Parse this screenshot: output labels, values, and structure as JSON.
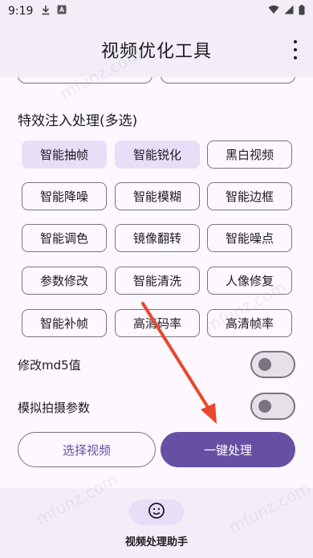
{
  "status_bar": {
    "time": "9:19",
    "icons": [
      "download-icon",
      "a-box-icon"
    ],
    "right_icons": [
      "wifi-icon",
      "signal-icon",
      "battery-icon"
    ]
  },
  "app_bar": {
    "title": "视频优化工具",
    "menu_icon": "more-vert-icon"
  },
  "effects": {
    "section_title": "特效注入处理(多选)",
    "chips": [
      {
        "label": "智能抽帧",
        "selected": true
      },
      {
        "label": "智能锐化",
        "selected": true
      },
      {
        "label": "黑白视频",
        "selected": false
      },
      {
        "label": "智能降噪",
        "selected": false
      },
      {
        "label": "智能模糊",
        "selected": false
      },
      {
        "label": "智能边框",
        "selected": false
      },
      {
        "label": "智能调色",
        "selected": false
      },
      {
        "label": "镜像翻转",
        "selected": false
      },
      {
        "label": "智能噪点",
        "selected": false
      },
      {
        "label": "参数修改",
        "selected": false
      },
      {
        "label": "智能清洗",
        "selected": false
      },
      {
        "label": "人像修复",
        "selected": false
      },
      {
        "label": "智能补帧",
        "selected": false
      },
      {
        "label": "高清码率",
        "selected": false
      },
      {
        "label": "高清帧率",
        "selected": false
      }
    ]
  },
  "toggles": [
    {
      "label": "修改md5值",
      "on": false
    },
    {
      "label": "模拟拍摄参数",
      "on": false
    }
  ],
  "actions": {
    "select_video": "选择视频",
    "process": "一键处理"
  },
  "bottom_nav": {
    "label": "视频处理助手",
    "icon": "smiley-face-icon"
  },
  "colors": {
    "primary": "#6750a4",
    "chip_selected": "#e8def8",
    "annotation_arrow": "#e8472b"
  },
  "watermark": "mfunz.com"
}
